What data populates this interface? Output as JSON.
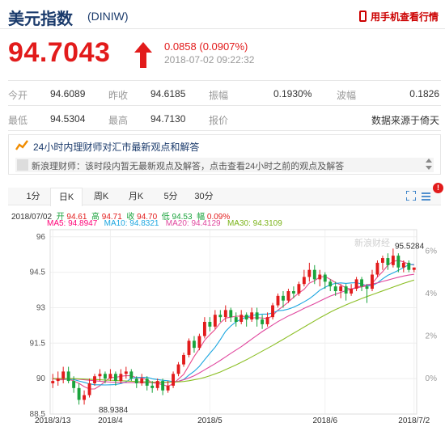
{
  "header": {
    "name": "美元指数",
    "code": "(DINIW)",
    "mobile_link": "用手机查看行情"
  },
  "quote": {
    "price": "94.7043",
    "change": "0.0858 (0.0907%)",
    "timestamp": "2018-07-02 09:22:32",
    "direction": "up",
    "color_up": "#e21b1b"
  },
  "stats": [
    [
      {
        "label": "今开",
        "value": "94.6089"
      },
      {
        "label": "昨收",
        "value": "94.6185"
      },
      {
        "label": "振幅",
        "value": "0.1930%"
      },
      {
        "label": "波幅",
        "value": "0.1826"
      }
    ],
    [
      {
        "label": "最低",
        "value": "94.5304"
      },
      {
        "label": "最高",
        "value": "94.7130"
      },
      {
        "label": "报价",
        "value": ""
      },
      {
        "label": "",
        "value": "数据来源于倚天"
      }
    ]
  ],
  "news": {
    "title": "24小时内理财师对汇市最新观点和解答",
    "line": "新浪理财师：该时段内暂无最新观点及解答，点击查看24小时之前的观点及解答"
  },
  "tabs": [
    {
      "label": "1分",
      "active": false
    },
    {
      "label": "日K",
      "active": true
    },
    {
      "label": "周K",
      "active": false
    },
    {
      "label": "月K",
      "active": false
    },
    {
      "label": "5分",
      "active": false
    },
    {
      "label": "30分",
      "active": false
    }
  ],
  "settings_badge": "!",
  "bar_info": {
    "date": "2018/07/02",
    "open_label": "开",
    "open": "94.61",
    "high_label": "高",
    "high": "94.71",
    "close_label": "收",
    "close": "94.70",
    "low_label": "低",
    "low": "94.53",
    "amp_label": "幅",
    "amp": "0.09%"
  },
  "ma_info": {
    "ma5": "MA5: 94.8947",
    "ma10": "MA10: 94.8321",
    "ma20": "MA20: 94.4129",
    "ma30": "MA30: 94.3109"
  },
  "chart_data": {
    "type": "candlestick",
    "y_ticks": [
      "96",
      "94.5",
      "93",
      "91.5",
      "90",
      "88.5"
    ],
    "y_range": [
      88.5,
      96.3
    ],
    "pct_ticks": [
      "6%",
      "4%",
      "2%",
      "0%"
    ],
    "x_ticks": [
      "2018/3/13",
      "2018/4",
      "2018/5",
      "2018/6",
      "2018/7/2"
    ],
    "max_label": "95.5284",
    "min_label": "88.9384",
    "watermark": "新浪财经",
    "candle_colors": {
      "up": "#e21b1b",
      "down": "#1aa33c"
    },
    "candles": [
      [
        89.8,
        89.9,
        89.6,
        90.2
      ],
      [
        89.9,
        90.0,
        89.7,
        90.3
      ],
      [
        90.0,
        90.3,
        89.8,
        90.5
      ],
      [
        90.3,
        89.9,
        89.8,
        90.5
      ],
      [
        89.9,
        89.6,
        89.4,
        90.1
      ],
      [
        89.6,
        89.1,
        88.9,
        89.8
      ],
      [
        89.1,
        89.3,
        88.9,
        89.5
      ],
      [
        89.3,
        89.8,
        89.2,
        90.0
      ],
      [
        89.8,
        90.1,
        89.7,
        90.2
      ],
      [
        90.1,
        90.2,
        89.9,
        90.4
      ],
      [
        90.2,
        90.0,
        89.8,
        90.3
      ],
      [
        90.0,
        90.2,
        89.9,
        90.4
      ],
      [
        90.2,
        89.9,
        89.7,
        90.3
      ],
      [
        89.9,
        90.2,
        89.8,
        90.4
      ],
      [
        90.2,
        90.3,
        90.0,
        90.5
      ],
      [
        90.3,
        90.0,
        89.9,
        90.4
      ],
      [
        90.0,
        89.8,
        89.6,
        90.1
      ],
      [
        89.8,
        90.0,
        89.7,
        90.2
      ],
      [
        90.0,
        89.7,
        89.5,
        90.1
      ],
      [
        89.7,
        89.6,
        89.4,
        89.9
      ],
      [
        89.6,
        89.9,
        89.5,
        90.0
      ],
      [
        89.9,
        89.5,
        89.3,
        90.0
      ],
      [
        89.5,
        89.7,
        89.4,
        89.9
      ],
      [
        89.7,
        90.2,
        89.6,
        90.3
      ],
      [
        90.2,
        90.6,
        90.1,
        90.7
      ],
      [
        90.6,
        91.0,
        90.5,
        91.1
      ],
      [
        91.0,
        91.6,
        90.9,
        91.7
      ],
      [
        91.6,
        91.3,
        91.1,
        91.8
      ],
      [
        91.3,
        91.8,
        91.2,
        91.9
      ],
      [
        91.8,
        92.4,
        91.7,
        92.6
      ],
      [
        92.4,
        92.2,
        92.0,
        92.6
      ],
      [
        92.2,
        92.7,
        92.1,
        92.9
      ],
      [
        92.7,
        92.6,
        92.4,
        92.9
      ],
      [
        92.6,
        92.9,
        92.4,
        93.1
      ],
      [
        92.9,
        92.6,
        92.4,
        93.0
      ],
      [
        92.6,
        92.4,
        92.2,
        92.8
      ],
      [
        92.4,
        92.7,
        92.3,
        92.9
      ],
      [
        92.7,
        92.5,
        92.2,
        92.8
      ],
      [
        92.5,
        92.8,
        92.4,
        93.0
      ],
      [
        92.8,
        92.5,
        92.2,
        93.0
      ],
      [
        92.5,
        92.3,
        92.1,
        92.7
      ],
      [
        92.3,
        92.6,
        92.2,
        92.8
      ],
      [
        92.6,
        93.1,
        92.5,
        93.2
      ],
      [
        93.1,
        93.5,
        93.0,
        93.6
      ],
      [
        93.5,
        93.3,
        93.0,
        93.7
      ],
      [
        93.3,
        93.7,
        93.2,
        93.8
      ],
      [
        93.7,
        93.6,
        93.4,
        93.9
      ],
      [
        93.6,
        94.0,
        93.5,
        94.1
      ],
      [
        94.0,
        94.3,
        93.9,
        94.6
      ],
      [
        94.3,
        94.6,
        94.1,
        94.9
      ],
      [
        94.6,
        94.2,
        94.0,
        94.8
      ],
      [
        94.2,
        94.4,
        93.9,
        94.6
      ],
      [
        94.4,
        94.1,
        93.8,
        94.5
      ],
      [
        94.1,
        93.9,
        93.7,
        94.2
      ],
      [
        93.9,
        93.7,
        93.5,
        94.1
      ],
      [
        93.7,
        93.9,
        93.4,
        94.0
      ],
      [
        93.9,
        93.6,
        93.3,
        94.0
      ],
      [
        93.6,
        93.8,
        93.5,
        94.0
      ],
      [
        93.8,
        94.2,
        93.7,
        94.3
      ],
      [
        94.2,
        93.9,
        93.7,
        94.3
      ],
      [
        93.9,
        93.8,
        93.2,
        94.0
      ],
      [
        93.8,
        94.4,
        93.7,
        94.6
      ],
      [
        94.4,
        94.9,
        94.3,
        95.0
      ],
      [
        94.9,
        95.1,
        94.6,
        95.2
      ],
      [
        95.1,
        94.8,
        94.6,
        95.3
      ],
      [
        94.8,
        95.2,
        94.7,
        95.5
      ],
      [
        95.2,
        94.7,
        94.5,
        95.3
      ],
      [
        94.7,
        94.9,
        94.5,
        95.0
      ],
      [
        94.9,
        94.6,
        94.5,
        95.0
      ],
      [
        94.6,
        94.7,
        94.5,
        94.7
      ]
    ],
    "ma": [
      {
        "name": "MA5",
        "color": "#e94b8c",
        "values": [
          90.0,
          89.95,
          89.95,
          89.98,
          89.9,
          89.8,
          89.66,
          89.56,
          89.56,
          89.7,
          89.88,
          90.05,
          90.05,
          90.1,
          90.12,
          90.12,
          90.04,
          90.02,
          89.96,
          89.82,
          89.8,
          89.74,
          89.68,
          89.78,
          89.98,
          90.18,
          90.56,
          90.94,
          91.26,
          91.62,
          91.86,
          92.08,
          92.36,
          92.56,
          92.6,
          92.64,
          92.64,
          92.62,
          92.56,
          92.58,
          92.56,
          92.54,
          92.66,
          92.9,
          93.06,
          93.24,
          93.44,
          93.62,
          93.78,
          94.04,
          94.14,
          94.3,
          94.32,
          94.2,
          94.06,
          93.96,
          93.84,
          93.78,
          93.84,
          93.88,
          93.92,
          94.02,
          94.3,
          94.52,
          94.8,
          94.96,
          95.0,
          94.94,
          94.84,
          94.8
        ]
      },
      {
        "name": "MA10",
        "color": "#1ba6e0",
        "values": [
          90.0,
          90.0,
          89.98,
          89.98,
          89.96,
          89.9,
          89.84,
          89.78,
          89.74,
          89.74,
          89.73,
          89.74,
          89.75,
          89.79,
          89.86,
          90.01,
          90.05,
          90.05,
          90.06,
          89.99,
          89.96,
          89.93,
          89.91,
          89.87,
          89.89,
          89.96,
          90.15,
          90.31,
          90.52,
          90.8,
          91.07,
          91.33,
          91.65,
          92.0,
          92.23,
          92.4,
          92.51,
          92.61,
          92.66,
          92.71,
          92.73,
          92.73,
          92.78,
          92.87,
          92.89,
          92.94,
          93.02,
          93.13,
          93.25,
          93.38,
          93.55,
          93.74,
          93.86,
          93.97,
          94.03,
          94.05,
          94.03,
          94.05,
          94.06,
          94.0,
          93.93,
          93.93,
          94.05,
          94.22,
          94.37,
          94.47,
          94.58,
          94.7,
          94.82,
          94.83
        ]
      },
      {
        "name": "MA20",
        "color": "#e0479e",
        "values": [
          90.0,
          90.0,
          90.0,
          90.0,
          89.99,
          89.97,
          89.95,
          89.93,
          89.91,
          89.89,
          89.87,
          89.85,
          89.84,
          89.83,
          89.83,
          89.83,
          89.83,
          89.82,
          89.83,
          89.83,
          89.83,
          89.84,
          89.84,
          89.86,
          89.89,
          89.95,
          90.03,
          90.12,
          90.24,
          90.37,
          90.5,
          90.63,
          90.77,
          90.92,
          91.07,
          91.21,
          91.35,
          91.51,
          91.67,
          91.83,
          91.99,
          92.13,
          92.27,
          92.41,
          92.53,
          92.65,
          92.75,
          92.86,
          92.97,
          93.07,
          93.17,
          93.28,
          93.39,
          93.49,
          93.57,
          93.65,
          93.72,
          93.79,
          93.86,
          93.92,
          93.97,
          94.0,
          94.05,
          94.11,
          94.17,
          94.23,
          94.29,
          94.34,
          94.38,
          94.41
        ]
      },
      {
        "name": "MA30",
        "color": "#8cbf26",
        "values": [
          90.0,
          90.0,
          90.0,
          90.0,
          90.0,
          89.99,
          89.98,
          89.97,
          89.96,
          89.95,
          89.94,
          89.93,
          89.92,
          89.91,
          89.9,
          89.89,
          89.88,
          89.87,
          89.86,
          89.85,
          89.85,
          89.85,
          89.85,
          89.85,
          89.86,
          89.88,
          89.91,
          89.95,
          89.99,
          90.05,
          90.12,
          90.2,
          90.28,
          90.38,
          90.48,
          90.58,
          90.69,
          90.8,
          90.92,
          91.04,
          91.16,
          91.28,
          91.4,
          91.53,
          91.66,
          91.79,
          91.92,
          92.05,
          92.18,
          92.31,
          92.44,
          92.57,
          92.69,
          92.81,
          92.92,
          93.02,
          93.12,
          93.21,
          93.3,
          93.39,
          93.47,
          93.55,
          93.63,
          93.71,
          93.79,
          93.87,
          93.95,
          94.03,
          94.1,
          94.17
        ]
      }
    ]
  }
}
